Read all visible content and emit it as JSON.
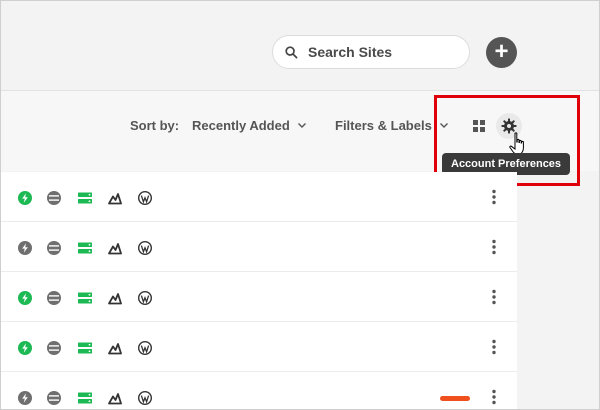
{
  "search": {
    "placeholder": "Search Sites"
  },
  "toolbar": {
    "sort_label": "Sort by:",
    "sort_value": "Recently Added",
    "filters_label": "Filters & Labels",
    "tooltip": "Account Preferences"
  },
  "colors": {
    "accent_green": "#1db954",
    "inactive_gray": "#6f6f6f",
    "highlight_red": "#e0000a",
    "bar_orange": "#f0501e"
  },
  "rows": [
    {
      "performance_active": true
    },
    {
      "performance_active": false
    },
    {
      "performance_active": true
    },
    {
      "performance_active": true
    },
    {
      "performance_active": false,
      "status_bar_color": "#f0501e"
    }
  ]
}
